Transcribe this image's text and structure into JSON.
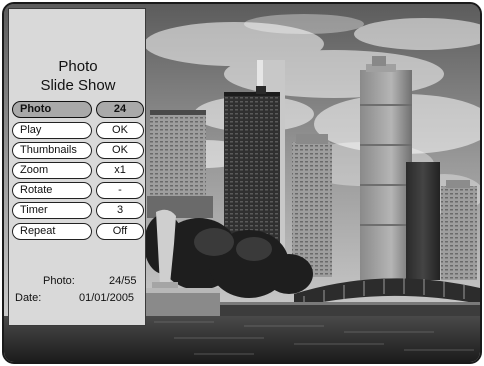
{
  "panel": {
    "title_line1": "Photo",
    "title_line2": "Slide Show"
  },
  "menu": [
    {
      "label": "Photo",
      "value": "24",
      "selected": true
    },
    {
      "label": "Play",
      "value": "OK",
      "selected": false
    },
    {
      "label": "Thumbnails",
      "value": "OK",
      "selected": false
    },
    {
      "label": "Zoom",
      "value": "x1",
      "selected": false
    },
    {
      "label": "Rotate",
      "value": "-",
      "selected": false
    },
    {
      "label": "Timer",
      "value": "3",
      "selected": false
    },
    {
      "label": "Repeat",
      "value": "Off",
      "selected": false
    }
  ],
  "info": {
    "photo_label": "Photo:",
    "photo_value": "24/55",
    "date_label": "Date:",
    "date_value": "01/01/2005"
  }
}
